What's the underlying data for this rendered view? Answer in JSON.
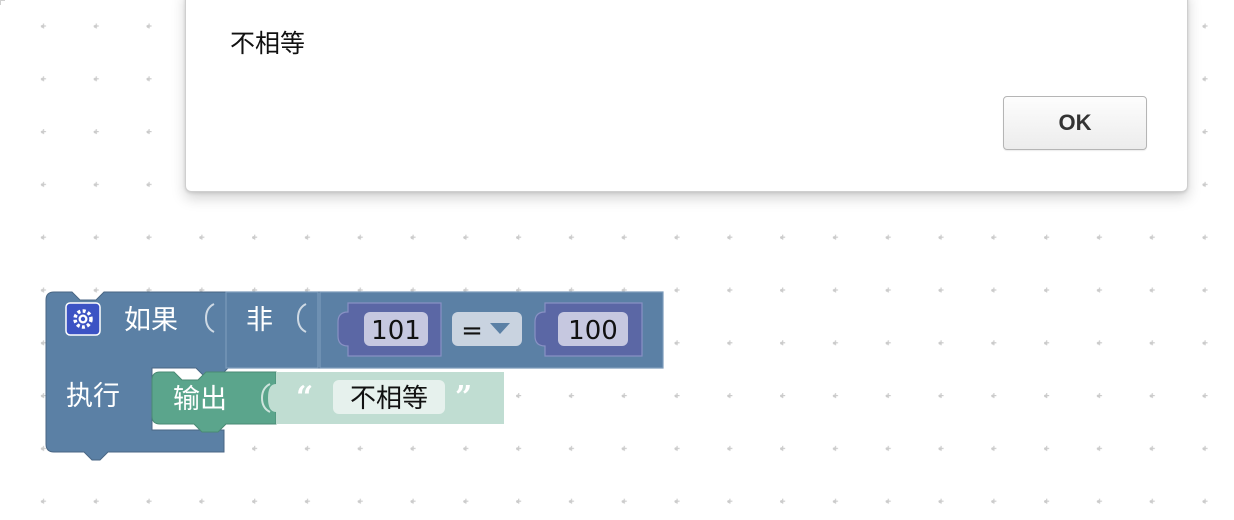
{
  "dialog": {
    "message": "不相等",
    "ok_label": "OK"
  },
  "blocks": {
    "if_label": "如果",
    "do_label": "执行",
    "not_label": "非",
    "left_number": "101",
    "operator": "=",
    "right_number": "100",
    "print_label": "输出",
    "string_value": "不相等",
    "open_quote": "“",
    "close_quote": "”"
  },
  "colors": {
    "logic_block": "#5b80a5",
    "compare_block": "#5b67a5",
    "number_block": "#5b67a5",
    "print_block": "#5ba58c",
    "text_block": "#c0ddd2"
  }
}
